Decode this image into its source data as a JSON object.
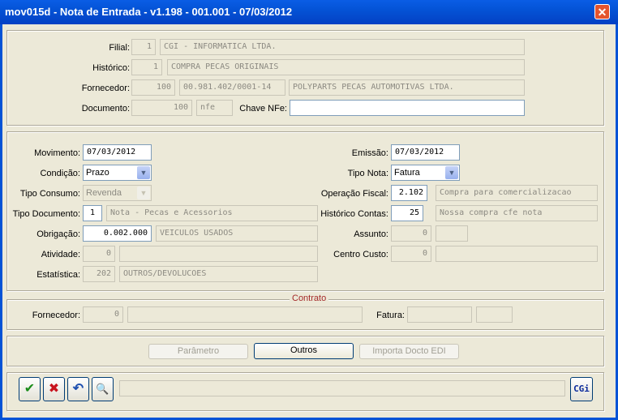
{
  "window": {
    "title": "mov015d - Nota de Entrada - v1.198 - 001.001 - 07/03/2012",
    "close_glyph": "✕"
  },
  "header": {
    "filial_label": "Filial:",
    "filial_code": "1",
    "filial_name": "CGI - INFORMATICA LTDA.",
    "historico_label": "Histórico:",
    "historico_code": "1",
    "historico_name": "COMPRA PECAS ORIGINAIS",
    "fornecedor_label": "Fornecedor:",
    "fornecedor_code": "100",
    "fornecedor_cnpj": "00.981.402/0001-14",
    "fornecedor_name": "POLYPARTS PECAS AUTOMOTIVAS LTDA.",
    "documento_label": "Documento:",
    "documento_num": "100",
    "documento_tipo": "nfe",
    "chave_label": "Chave NFe:",
    "chave_value": ""
  },
  "main": {
    "movimento_label": "Movimento:",
    "movimento_value": "07/03/2012",
    "condicao_label": "Condição:",
    "condicao_value": "Prazo",
    "tipo_consumo_label": "Tipo Consumo:",
    "tipo_consumo_value": "Revenda",
    "tipo_documento_label": "Tipo Documento:",
    "tipo_documento_code": "1",
    "tipo_documento_desc": "Nota - Pecas e Acessorios",
    "obrigacao_label": "Obrigação:",
    "obrigacao_code": "0.002.000",
    "obrigacao_desc": "VEICULOS USADOS",
    "atividade_label": "Atividade:",
    "atividade_code": "0",
    "atividade_desc": "",
    "estatistica_label": "Estatística:",
    "estatistica_code": "202",
    "estatistica_desc": "OUTROS/DEVOLUCOES",
    "emissao_label": "Emissão:",
    "emissao_value": "07/03/2012",
    "tipo_nota_label": "Tipo Nota:",
    "tipo_nota_value": "Fatura",
    "operacao_label": "Operação Fiscal:",
    "operacao_code": "2.102",
    "operacao_desc": "Compra para comercializacao",
    "hist_contas_label": "Histórico Contas:",
    "hist_contas_code": "25",
    "hist_contas_desc": "Nossa compra cfe nota",
    "assunto_label": "Assunto:",
    "assunto_code": "0",
    "assunto_desc": "",
    "centro_custo_label": "Centro Custo:",
    "centro_custo_code": "0",
    "centro_custo_desc": ""
  },
  "contrato": {
    "legend": "Contrato",
    "fornecedor_label": "Fornecedor:",
    "fornecedor_code": "0",
    "fornecedor_name": "",
    "fatura_label": "Fatura:",
    "fatura_value": "",
    "fatura_extra": ""
  },
  "actions": {
    "parametro_label": "Parâmetro",
    "outros_label": "Outros",
    "importa_label": "Importa Docto EDI"
  },
  "toolbar": {
    "confirm_glyph": "✔",
    "cancel_glyph": "✖",
    "undo_glyph": "↶",
    "search_glyph": "🔍",
    "status_text": "",
    "logo_text": "CGi"
  },
  "colors": {
    "title_bar": "#0453d6",
    "face": "#ece9d8",
    "legend": "#a52a2a"
  }
}
